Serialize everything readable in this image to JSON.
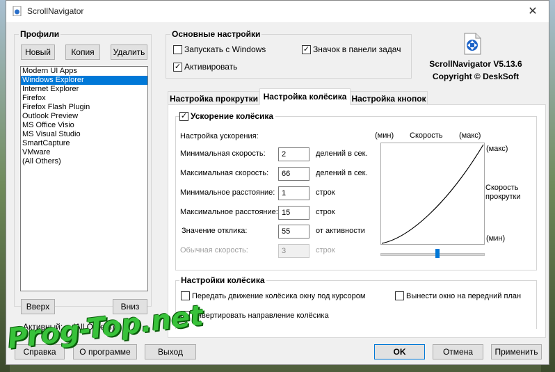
{
  "window": {
    "title": "ScrollNavigator",
    "close_glyph": "✕"
  },
  "profiles": {
    "title": "Профили",
    "buttons": {
      "new": "Новый",
      "copy": "Копия",
      "delete": "Удалить"
    },
    "items": [
      {
        "label": "Modern UI Apps",
        "selected": false
      },
      {
        "label": "Windows Explorer",
        "selected": true
      },
      {
        "label": "Internet Explorer",
        "selected": false
      },
      {
        "label": "Firefox",
        "selected": false
      },
      {
        "label": "Firefox Flash Plugin",
        "selected": false
      },
      {
        "label": "Outlook Preview",
        "selected": false
      },
      {
        "label": "MS Office Visio",
        "selected": false
      },
      {
        "label": "MS Visual Studio",
        "selected": false
      },
      {
        "label": "SmartCapture",
        "selected": false
      },
      {
        "label": "VMware",
        "selected": false
      },
      {
        "label": "(All Others)",
        "selected": false
      }
    ],
    "up": "Вверх",
    "down": "Вниз",
    "active_label": "Активный:",
    "active_value": "(All Others)"
  },
  "basic": {
    "title": "Основные настройки",
    "start_with_windows": {
      "label": "Запускать с Windows",
      "checked": false
    },
    "tray_icon": {
      "label": "Значок в панели задач",
      "checked": true
    },
    "activate": {
      "label": "Активировать",
      "checked": true
    }
  },
  "about": {
    "name": "ScrollNavigator V5.13.6",
    "copyright": "Copyright © DeskSoft"
  },
  "tabs": [
    {
      "label": "Настройка прокрутки",
      "active": false
    },
    {
      "label": "Настройка колёсика",
      "active": true
    },
    {
      "label": "Настройка кнопок",
      "active": false
    }
  ],
  "wheel": {
    "accel": {
      "label": "Ускорение колёсика",
      "checked": true
    },
    "accel_settings": "Настройка ускорения:",
    "rows": [
      {
        "label": "Минимальная скорость:",
        "value": "2",
        "unit": "делений в сек.",
        "disabled": false
      },
      {
        "label": "Максимальная скорость:",
        "value": "66",
        "unit": "делений в сек.",
        "disabled": false
      },
      {
        "label": "Минимальное расстояние:",
        "value": "1",
        "unit": "строк",
        "disabled": false
      },
      {
        "label": "Максимальное расстояние:",
        "value": "15",
        "unit": "строк",
        "disabled": false
      },
      {
        "label": "Значение отклика:",
        "value": "55",
        "unit": "от активности",
        "disabled": false
      },
      {
        "label": "Обычная скорость:",
        "value": "3",
        "unit": "строк",
        "disabled": true
      }
    ],
    "graph": {
      "min_top": "(мин)",
      "speed": "Скорость",
      "max_top": "(макс)",
      "max_right": "(макс)",
      "scroll_speed_1": "Скорость",
      "scroll_speed_2": "прокрутки",
      "min_right": "(мин)"
    },
    "response_slider_level": 0.55,
    "wheel_settings": {
      "title": "Настройки колёсика",
      "pass_under_cursor": {
        "label": "Передать движение колёсика окну под курсором",
        "checked": false
      },
      "bring_to_front": {
        "label": "Вынести окно на передний план",
        "checked": false
      },
      "invert": {
        "label": "Инвертировать направление колёсика",
        "checked": false
      }
    }
  },
  "footer": {
    "help": "Справка",
    "about": "О программе",
    "exit": "Выход",
    "ok": "OK",
    "cancel": "Отмена",
    "apply": "Применить"
  },
  "watermark": "Prog-Top.net"
}
